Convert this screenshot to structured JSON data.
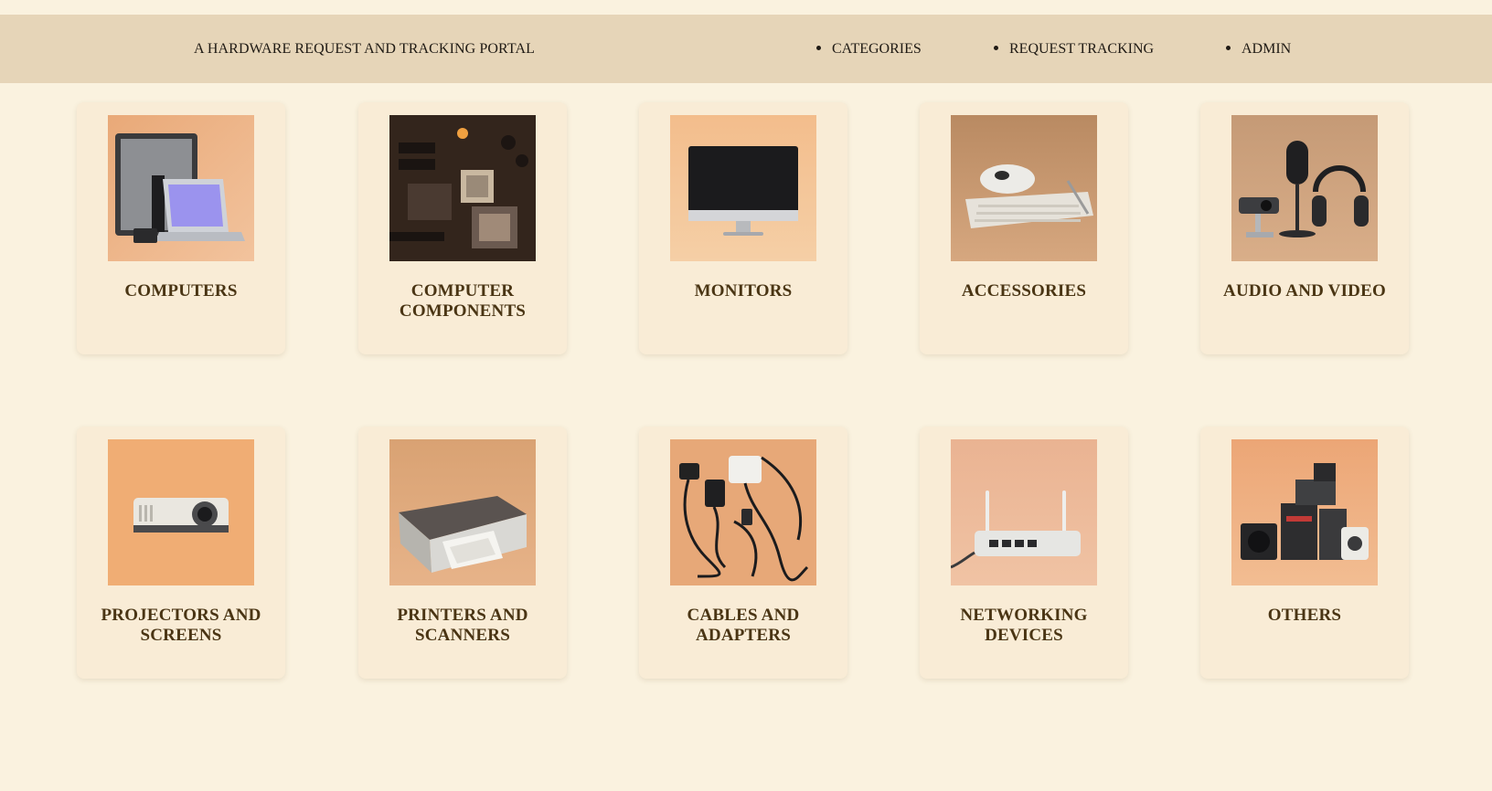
{
  "header": {
    "brand": "A HARDWARE REQUEST AND TRACKING PORTAL",
    "nav": [
      {
        "label": "CATEGORIES"
      },
      {
        "label": "REQUEST TRACKING"
      },
      {
        "label": "ADMIN"
      }
    ]
  },
  "categories": [
    {
      "label": "COMPUTERS",
      "icon": "computers-image"
    },
    {
      "label": "COMPUTER COMPONENTS",
      "icon": "computer-components-image"
    },
    {
      "label": "MONITORS",
      "icon": "monitors-image"
    },
    {
      "label": "ACCESSORIES",
      "icon": "accessories-image"
    },
    {
      "label": "AUDIO AND VIDEO",
      "icon": "audio-video-image"
    },
    {
      "label": "PROJECTORS AND SCREENS",
      "icon": "projectors-image"
    },
    {
      "label": "PRINTERS AND SCANNERS",
      "icon": "printers-image"
    },
    {
      "label": "CABLES AND ADAPTERS",
      "icon": "cables-image"
    },
    {
      "label": "NETWORKING DEVICES",
      "icon": "networking-image"
    },
    {
      "label": "OTHERS",
      "icon": "others-image"
    }
  ],
  "colors": {
    "page_background": "#faf2df",
    "header_background": "#e6d5b8",
    "card_background": "#f9ecd6",
    "card_title": "#4a3514"
  }
}
